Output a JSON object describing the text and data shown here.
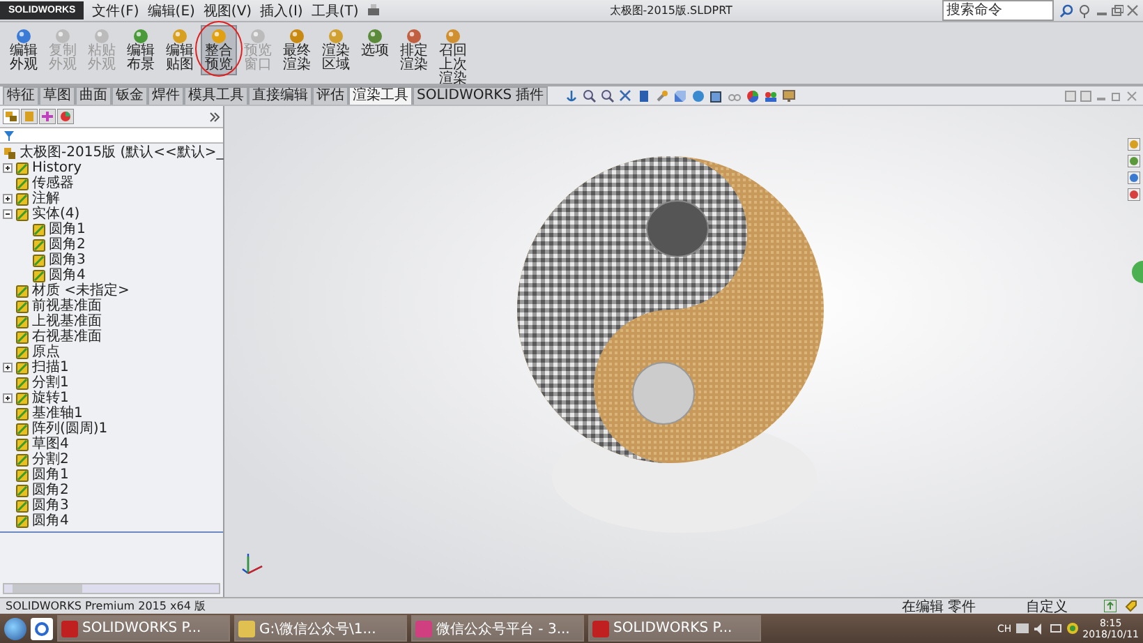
{
  "window": {
    "title": "太极图-2015版.SLDPRT",
    "app_logo": "SOLIDWORKS"
  },
  "menu": [
    "文件(F)",
    "编辑(E)",
    "视图(V)",
    "插入(I)",
    "工具(T)"
  ],
  "search": {
    "placeholder": "搜索命令"
  },
  "toolbar": [
    {
      "label": "编辑外观",
      "disabled": false,
      "selected": false,
      "annotated": false
    },
    {
      "label": "复制外观",
      "disabled": true,
      "selected": false,
      "annotated": false
    },
    {
      "label": "粘贴外观",
      "disabled": true,
      "selected": false,
      "annotated": false
    },
    {
      "label": "编辑布景",
      "disabled": false,
      "selected": false,
      "annotated": false
    },
    {
      "label": "编辑贴图",
      "disabled": false,
      "selected": false,
      "annotated": false
    },
    {
      "label": "整合预览",
      "disabled": false,
      "selected": true,
      "annotated": true
    },
    {
      "label": "预览窗口",
      "disabled": true,
      "selected": false,
      "annotated": false
    },
    {
      "label": "最终渲染",
      "disabled": false,
      "selected": false,
      "annotated": false
    },
    {
      "label": "渲染区域",
      "disabled": false,
      "selected": false,
      "annotated": false
    },
    {
      "label": "选项",
      "disabled": false,
      "selected": false,
      "annotated": false
    },
    {
      "label": "排定渲染",
      "disabled": false,
      "selected": false,
      "annotated": false
    },
    {
      "label": "召回上次渲染",
      "disabled": false,
      "selected": false,
      "annotated": false
    }
  ],
  "tabs": [
    {
      "label": "特征",
      "selected": false
    },
    {
      "label": "草图",
      "selected": false
    },
    {
      "label": "曲面",
      "selected": false
    },
    {
      "label": "钣金",
      "selected": false
    },
    {
      "label": "焊件",
      "selected": false
    },
    {
      "label": "模具工具",
      "selected": false
    },
    {
      "label": "直接编辑",
      "selected": false
    },
    {
      "label": "评估",
      "selected": false
    },
    {
      "label": "渲染工具",
      "selected": true
    },
    {
      "label": "SOLIDWORKS 插件",
      "selected": false
    }
  ],
  "tree": {
    "root": "太极图-2015版 (默认<<默认>_",
    "items": [
      {
        "label": "History",
        "expanded": false
      },
      {
        "label": "传感器"
      },
      {
        "label": "注解",
        "expanded": false
      },
      {
        "label": "实体(4)",
        "expanded": true,
        "children": [
          {
            "label": "圆角1"
          },
          {
            "label": "圆角2"
          },
          {
            "label": "圆角3"
          },
          {
            "label": "圆角4"
          }
        ]
      },
      {
        "label": "材质 <未指定>"
      },
      {
        "label": "前视基准面"
      },
      {
        "label": "上视基准面"
      },
      {
        "label": "右视基准面"
      },
      {
        "label": "原点"
      },
      {
        "label": "扫描1",
        "expanded": false
      },
      {
        "label": "分割1"
      },
      {
        "label": "旋转1",
        "expanded": false
      },
      {
        "label": "基准轴1"
      },
      {
        "label": "阵列(圆周)1"
      },
      {
        "label": "草图4"
      },
      {
        "label": "分割2"
      },
      {
        "label": "圆角1"
      },
      {
        "label": "圆角2"
      },
      {
        "label": "圆角3"
      },
      {
        "label": "圆角4"
      }
    ]
  },
  "status_bar": {
    "product": "SOLIDWORKS Premium 2015 x64 版",
    "mode": "在编辑 零件",
    "units": "自定义"
  },
  "taskbar": {
    "items": [
      "SOLIDWORKS P...",
      "G:\\微信公众号\\1...",
      "微信公众号平台 - 3...",
      "SOLIDWORKS P..."
    ],
    "lang": "CH",
    "time": "8:15",
    "date": "2018/10/11"
  }
}
